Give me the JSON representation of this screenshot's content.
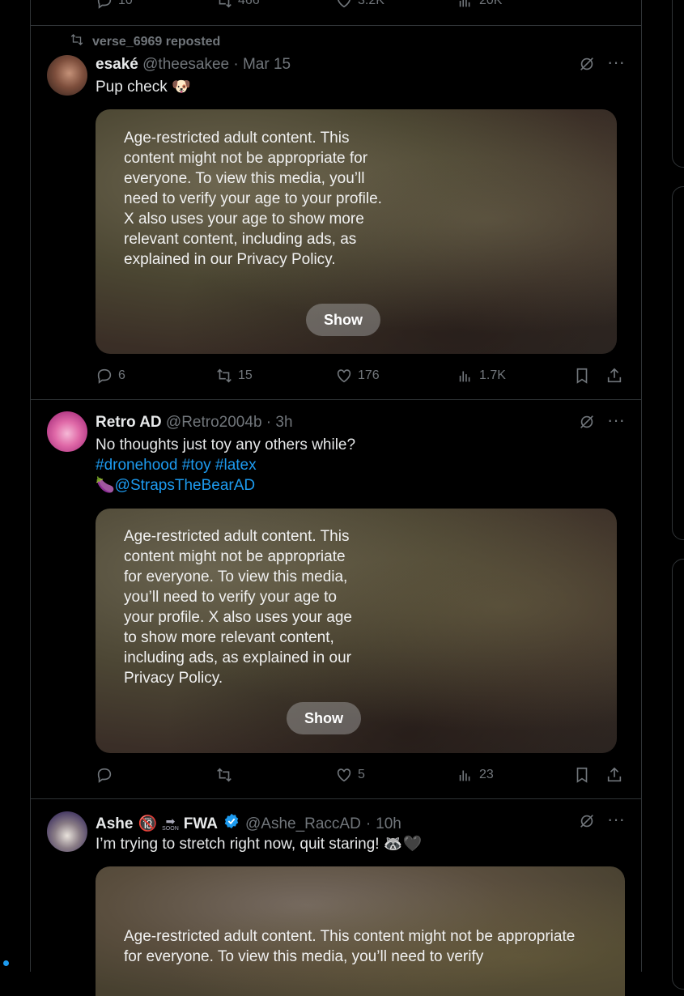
{
  "top_partial": {
    "replies": "10",
    "reposts": "466",
    "likes": "3.2K",
    "views": "20K"
  },
  "posts": [
    {
      "repost_label": "verse_6969 reposted",
      "name": "esaké",
      "handle": "@theesakee",
      "sep": "·",
      "time": "Mar 15",
      "text": "Pup check 🐶",
      "warning": "Age-restricted adult content. This content might not be appropriate for everyone. To view this media, you’ll need to verify your age to your profile. X also uses your age to show more relevant content, including ads, as explained in our Privacy Policy.",
      "show_label": "Show",
      "replies": "6",
      "reposts": "15",
      "likes": "176",
      "views": "1.7K"
    },
    {
      "name": "Retro AD",
      "handle": "@Retro2004b",
      "sep": "·",
      "time": "3h",
      "text_line1": "No thoughts just toy any others while?",
      "hashtags": [
        "#dronehood",
        "#toy",
        "#latex"
      ],
      "mention_prefix": "🍆",
      "mention": "@StrapsTheBearAD",
      "warning": "Age-restricted adult content. This content might not be appropriate for everyone. To view this media, you’ll need to verify your age to your profile. X also uses your age to show more relevant content, including ads, as explained in our Privacy Policy.",
      "show_label": "Show",
      "replies": "",
      "reposts": "",
      "likes": "5",
      "views": "23"
    },
    {
      "name": "Ashe",
      "name_emoji": "🔞",
      "soon_label": "SOON",
      "name_suffix": "FWA",
      "handle": "@Ashe_RaccAD",
      "sep": "·",
      "time": "10h",
      "text": "I’m trying to stretch right now, quit staring! 🦝🖤",
      "warning": "Age-restricted adult content. This content might not be appropriate for everyone. To view this media, you’ll need to verify"
    }
  ],
  "colors": {
    "link": "#1d9bf0",
    "muted": "#71767b",
    "border": "#2f3336",
    "verified": "#1d9bf0"
  }
}
